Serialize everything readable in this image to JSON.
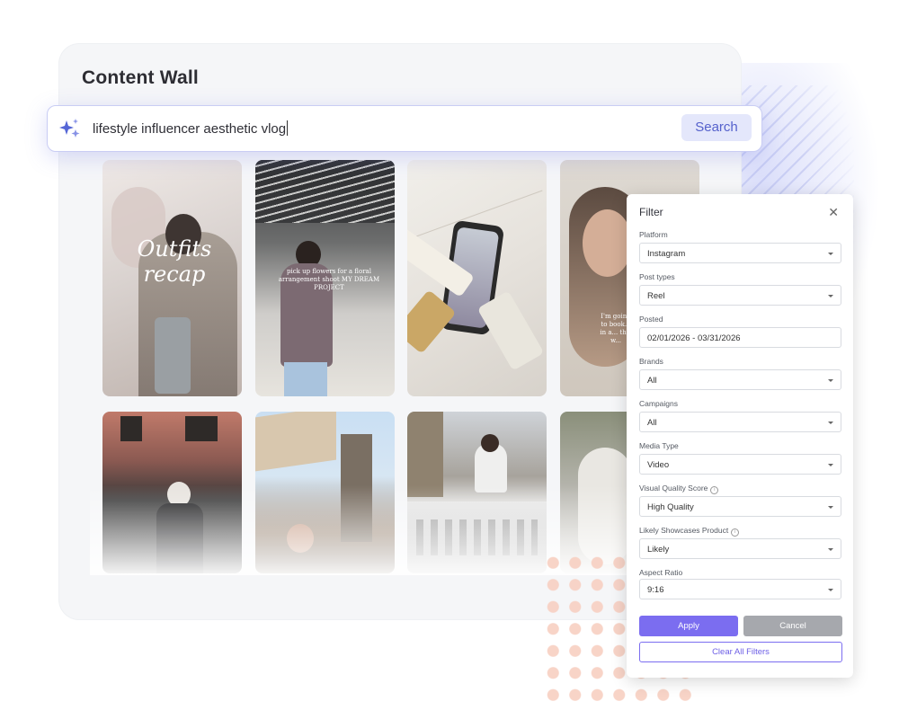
{
  "page": {
    "title": "Content Wall"
  },
  "search": {
    "query": "lifestyle influencer aesthetic vlog",
    "button_label": "Search"
  },
  "thumbnails": [
    {
      "overlay": "Outfits recap"
    },
    {
      "overlay": "pick up flowers for a floral arrangement shoot MY DREAM PROJECT"
    },
    {
      "overlay": ""
    },
    {
      "overlay": "I'm going to book... in a... this w..."
    },
    {
      "overlay": ""
    },
    {
      "overlay": ""
    },
    {
      "overlay": ""
    },
    {
      "overlay": ""
    }
  ],
  "filter": {
    "title": "Filter",
    "fields": [
      {
        "label": "Platform",
        "value": "Instagram",
        "dropdown": true,
        "info": false
      },
      {
        "label": "Post types",
        "value": "Reel",
        "dropdown": true,
        "info": false
      },
      {
        "label": "Posted",
        "value": "02/01/2026 - 03/31/2026",
        "dropdown": false,
        "info": false
      },
      {
        "label": "Brands",
        "value": "All",
        "dropdown": true,
        "info": false
      },
      {
        "label": "Campaigns",
        "value": "All",
        "dropdown": true,
        "info": false
      },
      {
        "label": "Media Type",
        "value": "Video",
        "dropdown": true,
        "info": false
      },
      {
        "label": "Visual Quality Score",
        "value": "High Quality",
        "dropdown": true,
        "info": true
      },
      {
        "label": "Likely Showcases Product",
        "value": "Likely",
        "dropdown": true,
        "info": true
      },
      {
        "label": "Aspect Ratio",
        "value": "9:16",
        "dropdown": true,
        "info": false
      }
    ],
    "apply_label": "Apply",
    "cancel_label": "Cancel",
    "clear_label": "Clear All Filters"
  },
  "colors": {
    "accent": "#7b6df0",
    "search_button_bg": "#e4e7fb",
    "dots": "#f7cfc1"
  }
}
